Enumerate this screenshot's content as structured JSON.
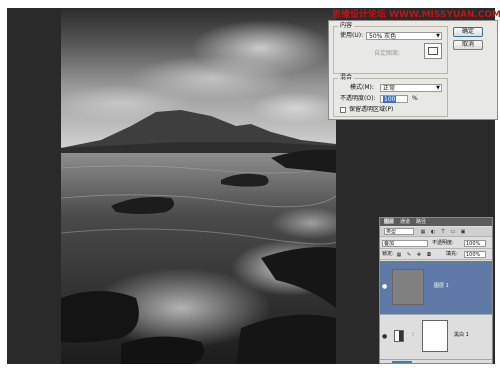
{
  "watermark": "思缘设计论坛  WWW.MISSYUAN.COM",
  "fill_dialog": {
    "contents_group_title": "内容",
    "use_label": "使用(U):",
    "use_value": "50% 灰色",
    "custom_pattern_label": "自定图案:",
    "blending_group_title": "混合",
    "mode_label": "模式(M):",
    "mode_value": "正常",
    "opacity_label": "不透明度(O):",
    "opacity_value": "100",
    "opacity_unit": "%",
    "preserve_transparency_label": "保留透明区域(P)",
    "ok_label": "确定",
    "cancel_label": "取消"
  },
  "layers_panel": {
    "tabs": [
      "图层",
      "通道",
      "路径"
    ],
    "kind_filter": "类型",
    "blend_mode": "叠加",
    "opacity_label": "不透明度:",
    "opacity_value": "100%",
    "lock_label": "锁定:",
    "fill_label": "填充:",
    "fill_value": "100%",
    "layers": [
      {
        "name": "图层 1"
      },
      {
        "name": "黑白 1"
      }
    ]
  }
}
